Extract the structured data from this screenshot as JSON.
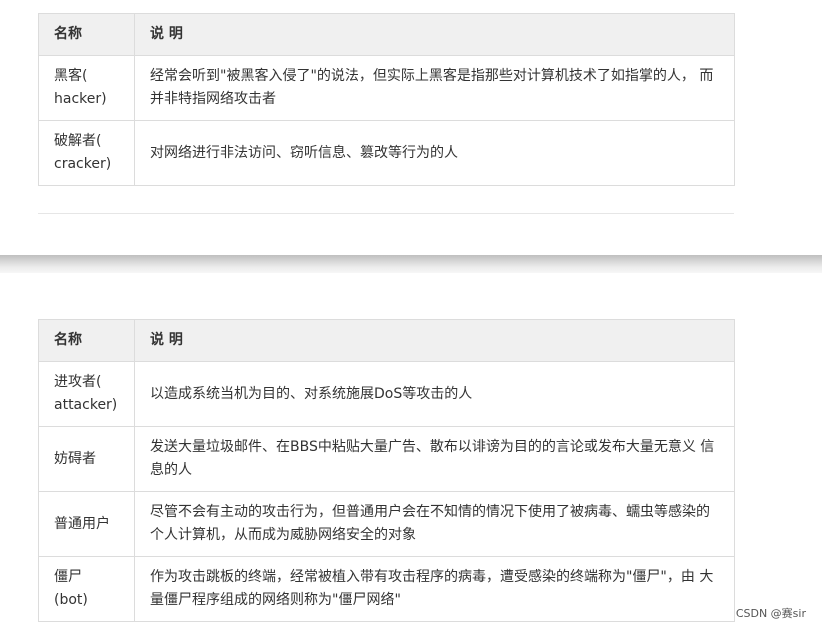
{
  "table1": {
    "header": {
      "name": "名称",
      "desc": "说 明"
    },
    "rows": [
      {
        "name": "黑客(\nhacker)",
        "desc": "经常会听到\"被黑客入侵了\"的说法，但实际上黑客是指那些对计算机技术了如指掌的人， 而并非特指网络攻击者"
      },
      {
        "name": "破解者(\ncracker)",
        "desc": "对网络进行非法访问、窃听信息、篡改等行为的人"
      }
    ]
  },
  "table2": {
    "header": {
      "name": "名称",
      "desc": "说 明"
    },
    "rows": [
      {
        "name": "进攻者(\nattacker)",
        "desc": "以造成系统当机为目的、对系统施展DoS等攻击的人"
      },
      {
        "name": "妨碍者",
        "desc": "发送大量垃圾邮件、在BBS中粘贴大量广告、散布以诽谤为目的的言论或发布大量无意义 信息的人"
      },
      {
        "name": "普通用户",
        "desc": "尽管不会有主动的攻击行为，但普通用户会在不知情的情况下使用了被病毒、蠕虫等感染的 个人计算机，从而成为威胁网络安全的对象"
      },
      {
        "name": "僵尸\n(bot)",
        "desc": "作为攻击跳板的终端，经常被植入带有攻击程序的病毒，遭受感染的终端称为\"僵尸\"，由 大量僵尸程序组成的网络则称为\"僵尸网络\""
      }
    ]
  },
  "watermark": "CSDN @赛sir"
}
